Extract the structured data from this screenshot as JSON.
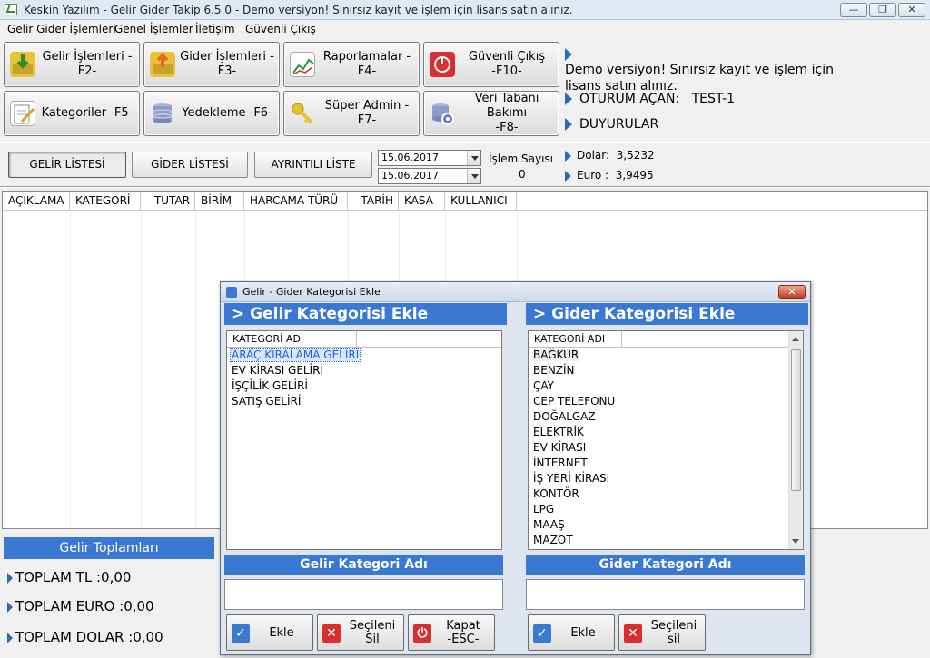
{
  "window": {
    "title": "Keskin Yazılım - Gelir Gider Takip 6.5.0  - Demo versiyon! Sınırsız kayıt ve işlem için lisans satın alınız.",
    "min": "—",
    "max": "❐",
    "close": "✕"
  },
  "menu": [
    "Gelir Gider İşlemleri",
    "Genel İşlemler",
    "İletişim",
    "Güvenli Çıkış"
  ],
  "toolbar": {
    "gelir": "Gelir İşlemleri -F2-",
    "gider": "Gider İşlemleri -F3-",
    "rapor": "Raporlamalar -F4-",
    "cikis_line1": "Güvenli Çıkış",
    "cikis_line2": "-F10-",
    "kategori": "Kategoriler -F5-",
    "yedek": "Yedekleme -F6-",
    "admin": "Süper Admin -F7-",
    "bakim_line1": "Veri Tabanı Bakımı",
    "bakim_line2": "-F8-"
  },
  "info": {
    "demo_line1": "Demo versiyon! Sınırsız kayıt ve işlem için",
    "demo_line2": "lisans satın alınız.",
    "oturum_label": "OTURUM AÇAN:",
    "oturum_user": "TEST-1",
    "duyurular": "DUYURULAR"
  },
  "tabs": {
    "gelir": "GELİR LİSTESİ",
    "gider": "GİDER LİSTESİ",
    "ayrintili": "AYRINTILI LİSTE"
  },
  "dates": {
    "start": "15.06.2017",
    "end": "15.06.2017"
  },
  "islem": {
    "label": "İşlem Sayısı",
    "count": "0"
  },
  "rates": {
    "dolar_label": "Dolar:",
    "dolar": "3,5232",
    "euro_label": "Euro :",
    "euro": "3,9495"
  },
  "grid_columns": [
    "AÇIKLAMA",
    "KATEGORİ",
    "TUTAR",
    "BİRİM",
    "HARCAMA TÜRÜ",
    "TARİH",
    "KASA",
    "KULLANICI"
  ],
  "totals": {
    "title": "Gelir Toplamları",
    "tl": "TOPLAM TL :0,00",
    "euro": "TOPLAM EURO :0,00",
    "dolar": "TOPLAM DOLAR :0,00"
  },
  "dialog": {
    "title": "Gelir - Gider Kategorisi Ekle",
    "close": "✕",
    "gelir_header": "> Gelir Kategorisi Ekle",
    "gider_header": "> Gider Kategorisi Ekle",
    "col_header": "KATEGORİ ADI",
    "gelir_items": [
      "ARAÇ KİRALAMA GELİRİ",
      "EV KİRASI GELİRİ",
      "İŞÇİLİK GELİRİ",
      "SATIŞ GELİRİ"
    ],
    "gider_items": [
      "BAĞKUR",
      "BENZİN",
      "ÇAY",
      "CEP TELEFONU",
      "DOĞALGAZ",
      "ELEKTRİK",
      "EV KİRASI",
      "İNTERNET",
      "İŞ YERİ KİRASI",
      "KONTÖR",
      "LPG",
      "MAAŞ",
      "MAZOT"
    ],
    "gelir_input_label": "Gelir Kategori Adı",
    "gider_input_label": "Gider  Kategori Adı",
    "ekle": "Ekle",
    "secileni_sil": "Seçileni Sil",
    "secileni_sil2": "Seçileni sil",
    "kapat_line1": "Kapat",
    "kapat_line2": "-ESC-",
    "ekle2": "Ekle"
  },
  "colors": {
    "accent": "#3a78d4",
    "arrow": "#2a6bb8",
    "danger": "#d9302f"
  }
}
